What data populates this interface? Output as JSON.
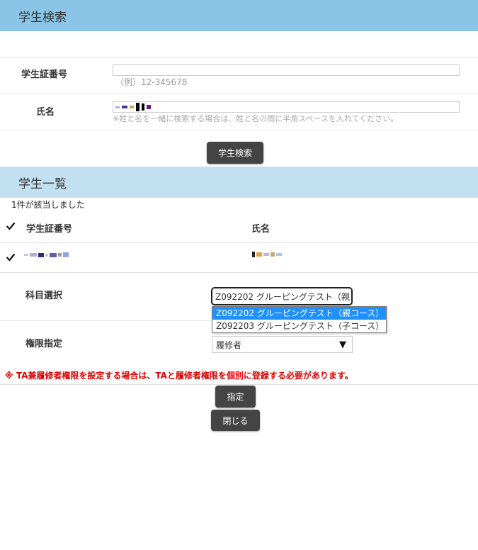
{
  "search_section": {
    "title": "学生検索",
    "student_id_label": "学生証番号",
    "student_id_value": "",
    "student_id_example": "（例）12-345678",
    "name_label": "氏名",
    "name_hint": "※姓と名を一緒に検索する場合は、姓と名の間に半角スペースを入れてください。",
    "search_button": "学生検索"
  },
  "list_section": {
    "title": "学生一覧",
    "result_count": "1件が該当しました",
    "col_student_id": "学生証番号",
    "col_name": "氏名",
    "rows": [
      {
        "checked": true
      }
    ]
  },
  "course_select": {
    "label": "科目選択",
    "selected_text": "Z092202 グルーピングテスト（親コース）",
    "options": [
      "Z092202 グルーピングテスト（親コース）",
      "Z092203 グルーピングテスト（子コース）"
    ]
  },
  "role_select": {
    "label": "権限指定",
    "selected_text": "履修者",
    "arrow": "▼"
  },
  "warning": "※ TA兼履修者権限を設定する場合は、TAと履修者権限を個別に登録する必要があります。",
  "buttons": {
    "assign": "指定",
    "close": "閉じる"
  },
  "colors": {
    "search_header_bg": "#8ac4e6",
    "list_header_bg": "#c3e0f1",
    "warning_text": "#e00000",
    "button_bg": "#444444",
    "dropdown_highlight": "#1e90ff"
  }
}
